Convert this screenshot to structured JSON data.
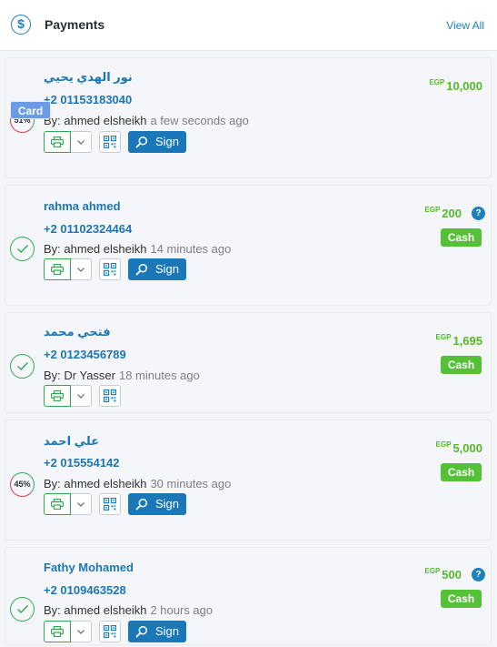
{
  "header": {
    "icon": "dollar-icon",
    "title": "Payments",
    "view_all": "View All"
  },
  "colors": {
    "accent": "#1c7fc0",
    "amount": "#55b829",
    "cash_badge": "#55c136",
    "card_badge": "#6c9be6",
    "sign_button": "#1b78b8",
    "status_done": "#2eaa51",
    "status_partial": "#d9374b"
  },
  "payments": [
    {
      "name": "نور الهدي يحيي",
      "phone": "+2 01153183040",
      "by": "By: ahmed elsheikh",
      "time": "a few seconds ago",
      "currency": "EGP",
      "amount": "10,000",
      "method": "Card",
      "status_text": "51%",
      "sign_label": "Sign"
    },
    {
      "name": "rahma ahmed",
      "phone": "+2 01102324464",
      "by": "By: ahmed elsheikh",
      "time": "14 minutes ago",
      "currency": "EGP",
      "amount": "200",
      "method": "Cash",
      "help": "?",
      "sign_label": "Sign"
    },
    {
      "name": "فتحي محمد",
      "phone": "+2 0123456789",
      "by": "By: Dr Yasser",
      "time": "18 minutes ago",
      "currency": "EGP",
      "amount": "1,695",
      "method": "Cash"
    },
    {
      "name": "علي احمد",
      "phone": "+2 015554142",
      "by": "By: ahmed elsheikh",
      "time": "30 minutes ago",
      "currency": "EGP",
      "amount": "5,000",
      "method": "Cash",
      "status_text": "45%",
      "sign_label": "Sign"
    },
    {
      "name": "Fathy Mohamed",
      "phone": "+2 0109463528",
      "by": "By: ahmed elsheikh",
      "time": "2 hours ago",
      "currency": "EGP",
      "amount": "500",
      "method": "Cash",
      "help": "?",
      "sign_label": "Sign"
    }
  ]
}
